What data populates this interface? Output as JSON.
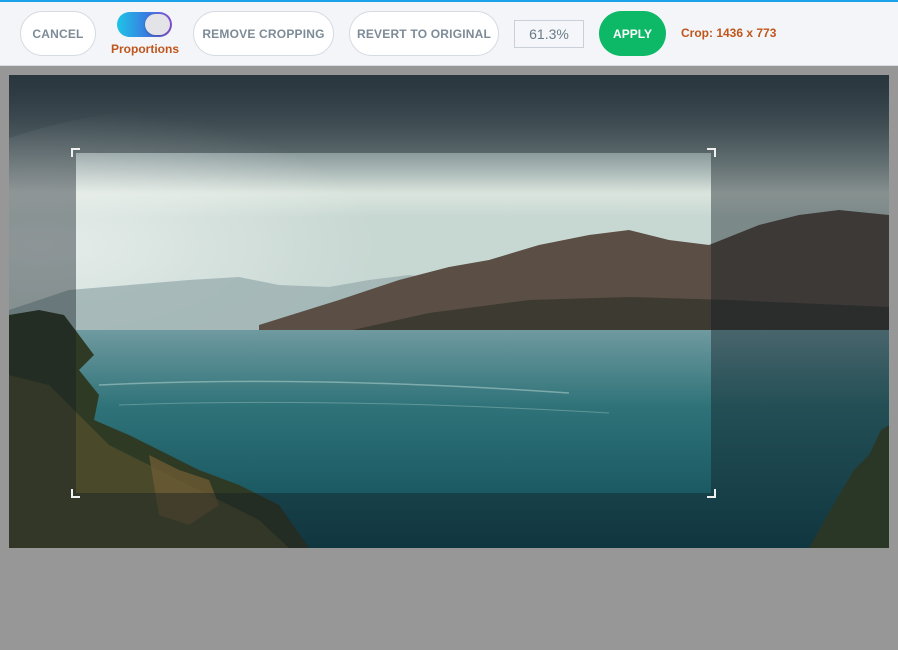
{
  "toolbar": {
    "cancel_label": "CANCEL",
    "proportions_label": "Proportions",
    "proportions_on": true,
    "remove_cropping_label": "REMOVE CROPPING",
    "revert_label": "REVERT TO ORIGINAL",
    "zoom": "61.3%",
    "apply_label": "APPLY",
    "crop_info": "Crop: 1436 x 773"
  },
  "colors": {
    "accent_line": "#1aa3e8",
    "apply_green": "#0db866",
    "label_orange": "#c0561c",
    "toggle_gradient": [
      "#1ec4e6",
      "#3a7be0",
      "#8a4fd6"
    ]
  },
  "canvas": {
    "image_subject": "lake-landscape-photo",
    "corner_icons": [
      "crop-corner-top-left-icon",
      "crop-corner-top-right-icon",
      "crop-corner-bottom-left-icon",
      "crop-corner-bottom-right-icon"
    ]
  }
}
